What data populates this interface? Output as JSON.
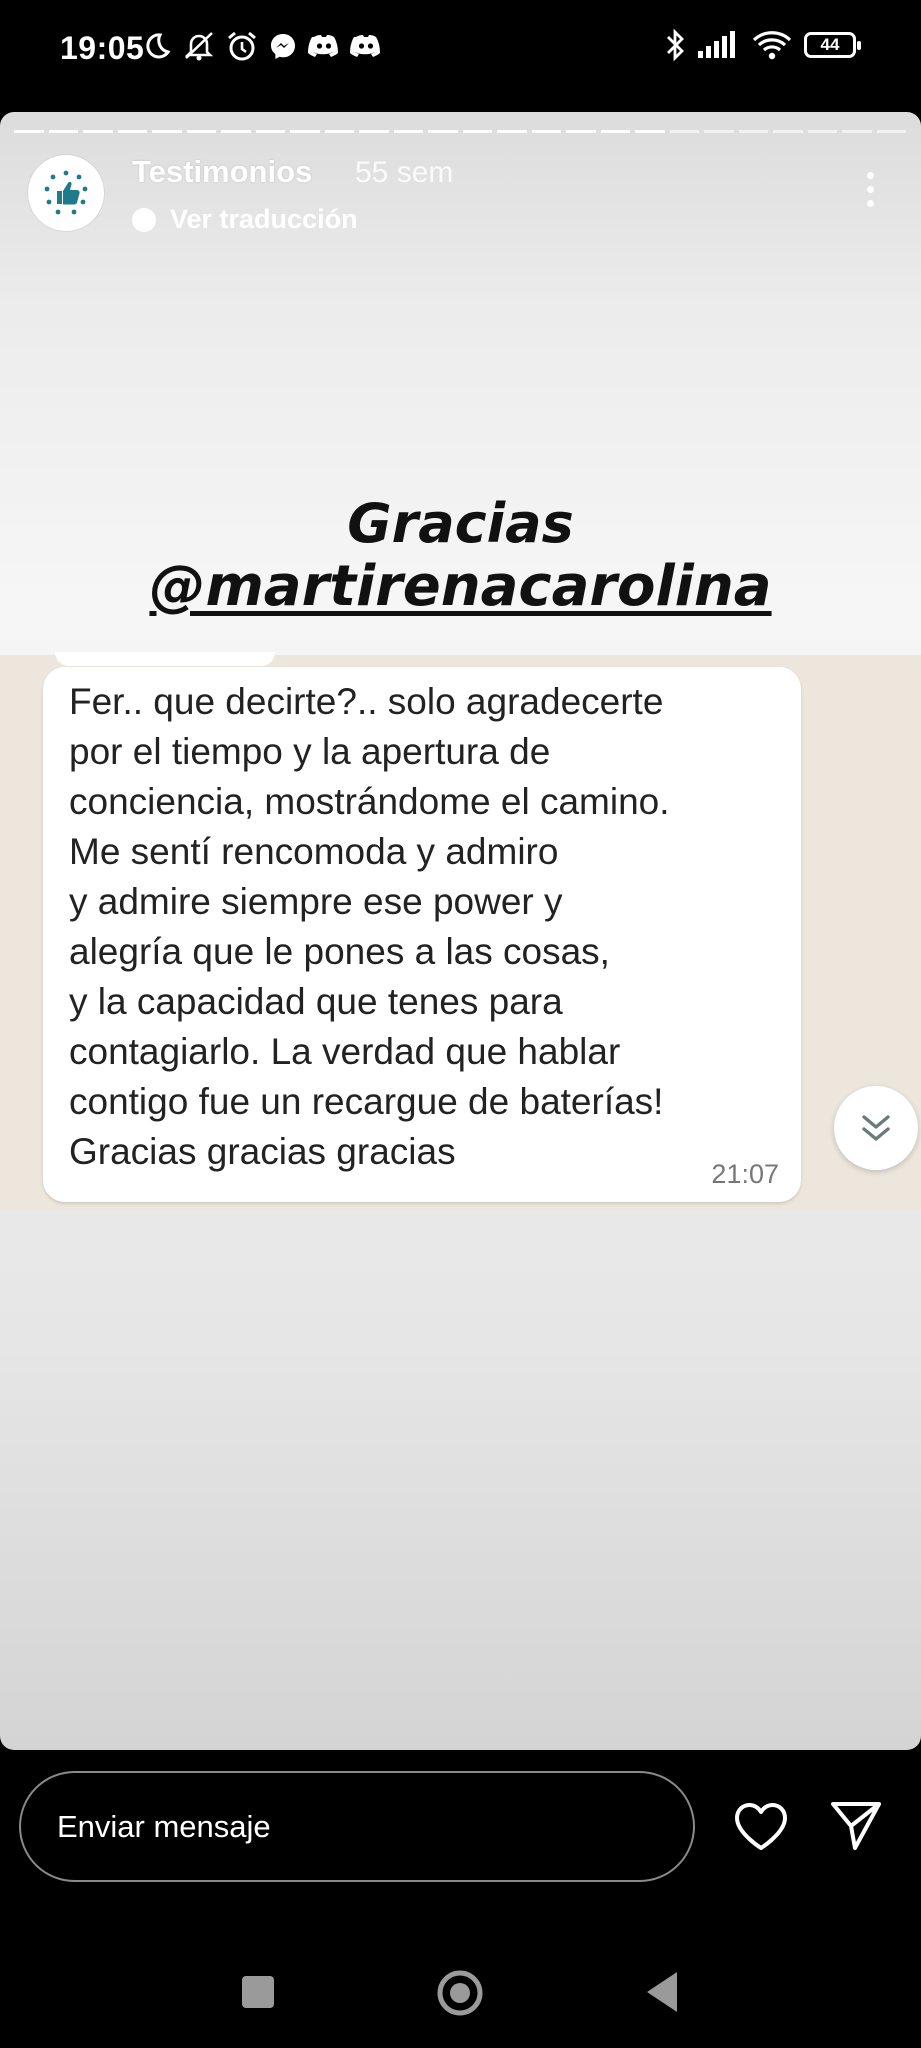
{
  "status_bar": {
    "time": "19:05",
    "battery": "44",
    "left_icons": [
      "moon-icon",
      "mute-icon",
      "alarm-icon",
      "messenger-icon",
      "discord-icon",
      "discord-icon"
    ],
    "right_icons": [
      "bluetooth-icon",
      "signal-icon",
      "wifi-icon",
      "battery-icon"
    ]
  },
  "story": {
    "username": "Testimonios",
    "time_ago": "55 sem",
    "translate_label": "Ver traducción",
    "progress_segments": 26,
    "progress_current": 19
  },
  "content": {
    "heading_line1": "Gracias",
    "heading_line2": "@martirenacarolina",
    "message_lines": [
      "Fer.. que decirte?.. solo agradecerte",
      "por el tiempo y la apertura de",
      "conciencia, mostrándome el camino.",
      "Me sentí rencomoda y admiro",
      "y admire siempre ese power y",
      "alegría que le pones a las cosas,",
      "y la capacidad que tenes para",
      "contagiarlo. La verdad que hablar",
      "contigo fue un recargue de baterías!",
      "Gracias gracias gracias"
    ],
    "message_time": "21:07"
  },
  "composer": {
    "placeholder": "Enviar mensaje"
  },
  "colors": {
    "accent": "#1f7a8c",
    "background": "#000000"
  }
}
